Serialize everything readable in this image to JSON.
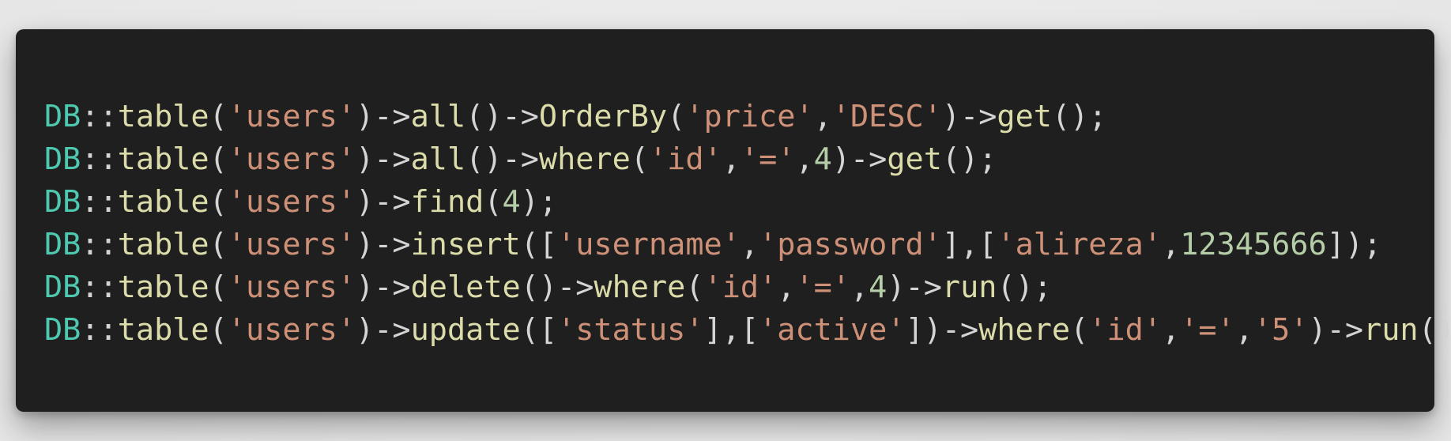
{
  "code": {
    "lines": [
      {
        "tokens": [
          {
            "text": "DB",
            "type": "class"
          },
          {
            "text": "::",
            "type": "op"
          },
          {
            "text": "table",
            "type": "func"
          },
          {
            "text": "(",
            "type": "op"
          },
          {
            "text": "'users'",
            "type": "str"
          },
          {
            "text": ")->",
            "type": "op"
          },
          {
            "text": "all",
            "type": "func"
          },
          {
            "text": "()->",
            "type": "op"
          },
          {
            "text": "OrderBy",
            "type": "func"
          },
          {
            "text": "(",
            "type": "op"
          },
          {
            "text": "'price'",
            "type": "str"
          },
          {
            "text": ",",
            "type": "op"
          },
          {
            "text": "'DESC'",
            "type": "str"
          },
          {
            "text": ")->",
            "type": "op"
          },
          {
            "text": "get",
            "type": "func"
          },
          {
            "text": "();",
            "type": "op"
          }
        ]
      },
      {
        "tokens": [
          {
            "text": "DB",
            "type": "class"
          },
          {
            "text": "::",
            "type": "op"
          },
          {
            "text": "table",
            "type": "func"
          },
          {
            "text": "(",
            "type": "op"
          },
          {
            "text": "'users'",
            "type": "str"
          },
          {
            "text": ")->",
            "type": "op"
          },
          {
            "text": "all",
            "type": "func"
          },
          {
            "text": "()->",
            "type": "op"
          },
          {
            "text": "where",
            "type": "func"
          },
          {
            "text": "(",
            "type": "op"
          },
          {
            "text": "'id'",
            "type": "str"
          },
          {
            "text": ",",
            "type": "op"
          },
          {
            "text": "'='",
            "type": "str"
          },
          {
            "text": ",",
            "type": "op"
          },
          {
            "text": "4",
            "type": "num"
          },
          {
            "text": ")->",
            "type": "op"
          },
          {
            "text": "get",
            "type": "func"
          },
          {
            "text": "();",
            "type": "op"
          }
        ]
      },
      {
        "tokens": [
          {
            "text": "DB",
            "type": "class"
          },
          {
            "text": "::",
            "type": "op"
          },
          {
            "text": "table",
            "type": "func"
          },
          {
            "text": "(",
            "type": "op"
          },
          {
            "text": "'users'",
            "type": "str"
          },
          {
            "text": ")->",
            "type": "op"
          },
          {
            "text": "find",
            "type": "func"
          },
          {
            "text": "(",
            "type": "op"
          },
          {
            "text": "4",
            "type": "num"
          },
          {
            "text": ");",
            "type": "op"
          }
        ]
      },
      {
        "tokens": [
          {
            "text": "DB",
            "type": "class"
          },
          {
            "text": "::",
            "type": "op"
          },
          {
            "text": "table",
            "type": "func"
          },
          {
            "text": "(",
            "type": "op"
          },
          {
            "text": "'users'",
            "type": "str"
          },
          {
            "text": ")->",
            "type": "op"
          },
          {
            "text": "insert",
            "type": "func"
          },
          {
            "text": "([",
            "type": "op"
          },
          {
            "text": "'username'",
            "type": "str"
          },
          {
            "text": ",",
            "type": "op"
          },
          {
            "text": "'password'",
            "type": "str"
          },
          {
            "text": "],[",
            "type": "op"
          },
          {
            "text": "'alireza'",
            "type": "str"
          },
          {
            "text": ",",
            "type": "op"
          },
          {
            "text": "12345666",
            "type": "num"
          },
          {
            "text": "]);",
            "type": "op"
          }
        ]
      },
      {
        "tokens": [
          {
            "text": "DB",
            "type": "class"
          },
          {
            "text": "::",
            "type": "op"
          },
          {
            "text": "table",
            "type": "func"
          },
          {
            "text": "(",
            "type": "op"
          },
          {
            "text": "'users'",
            "type": "str"
          },
          {
            "text": ")->",
            "type": "op"
          },
          {
            "text": "delete",
            "type": "func"
          },
          {
            "text": "()->",
            "type": "op"
          },
          {
            "text": "where",
            "type": "func"
          },
          {
            "text": "(",
            "type": "op"
          },
          {
            "text": "'id'",
            "type": "str"
          },
          {
            "text": ",",
            "type": "op"
          },
          {
            "text": "'='",
            "type": "str"
          },
          {
            "text": ",",
            "type": "op"
          },
          {
            "text": "4",
            "type": "num"
          },
          {
            "text": ")->",
            "type": "op"
          },
          {
            "text": "run",
            "type": "func"
          },
          {
            "text": "();",
            "type": "op"
          }
        ]
      },
      {
        "tokens": [
          {
            "text": "DB",
            "type": "class"
          },
          {
            "text": "::",
            "type": "op"
          },
          {
            "text": "table",
            "type": "func"
          },
          {
            "text": "(",
            "type": "op"
          },
          {
            "text": "'users'",
            "type": "str"
          },
          {
            "text": ")->",
            "type": "op"
          },
          {
            "text": "update",
            "type": "func"
          },
          {
            "text": "([",
            "type": "op"
          },
          {
            "text": "'status'",
            "type": "str"
          },
          {
            "text": "],[",
            "type": "op"
          },
          {
            "text": "'active'",
            "type": "str"
          },
          {
            "text": "])->",
            "type": "op"
          },
          {
            "text": "where",
            "type": "func"
          },
          {
            "text": "(",
            "type": "op"
          },
          {
            "text": "'id'",
            "type": "str"
          },
          {
            "text": ",",
            "type": "op"
          },
          {
            "text": "'='",
            "type": "str"
          },
          {
            "text": ",",
            "type": "op"
          },
          {
            "text": "'5'",
            "type": "str"
          },
          {
            "text": ")->",
            "type": "op"
          },
          {
            "text": "run",
            "type": "func"
          },
          {
            "text": "();",
            "type": "op"
          }
        ]
      }
    ]
  },
  "colors": {
    "background": "#1f1f1f",
    "class": "#4ec9b0",
    "function": "#dcdcaa",
    "string": "#ce9178",
    "number": "#b5cea8",
    "punctuation": "#d4d4d4"
  }
}
